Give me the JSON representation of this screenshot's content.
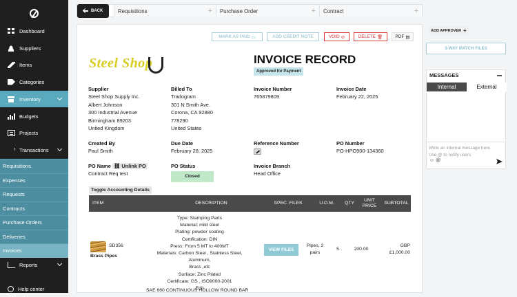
{
  "sidebar": {
    "items": [
      {
        "label": "Dashboard",
        "icon": "dashboard-icon"
      },
      {
        "label": "Suppliers",
        "icon": "users-icon"
      },
      {
        "label": "Items",
        "icon": "rocket-icon"
      },
      {
        "label": "Categories",
        "icon": "tag-icon"
      },
      {
        "label": "Inventory",
        "icon": "box-icon"
      },
      {
        "label": "Budgets",
        "icon": "bar-chart-icon"
      },
      {
        "label": "Projects",
        "icon": "sheet-icon"
      },
      {
        "label": "Transactions",
        "icon": "cart-icon"
      }
    ],
    "sub_items": [
      "Requisitions",
      "Expenses",
      "Requests",
      "Contracts",
      "Purchase Orders",
      "Deliveries",
      "Invoices"
    ],
    "reports": "Reports",
    "help": "Help center"
  },
  "topbar": {
    "back": "BACK",
    "tabs": [
      "Requisitions",
      "Purchase Order",
      "Contract"
    ]
  },
  "actions": {
    "mark_as_paid": "MARK AS PAID",
    "add_credit_note": "ADD CREDIT NOTE",
    "void": "VOID",
    "delete": "DELETE",
    "pdf": "PDF"
  },
  "invoice": {
    "brand": "Steel Shop",
    "title": "INVOICE RECORD",
    "status_badge": "Approved for Payment",
    "supplier": {
      "label": "Supplier",
      "lines": [
        "Steel Shop Supply Inc.",
        "Albert Johnson",
        "300 Industrial Avenue",
        "Birmingham 89203",
        "United Kingdom"
      ]
    },
    "billed_to": {
      "label": "Billed To",
      "lines": [
        "Tradogram",
        "301 N Smith Ave.",
        "Corona, CA 92880",
        "778290",
        "United States"
      ]
    },
    "invoice_number": {
      "label": "Invoice Number",
      "value": "765879809"
    },
    "invoice_date": {
      "label": "Invoice Date",
      "value": "February 22, 2025"
    },
    "created_by": {
      "label": "Created By",
      "value": "Paul Smith"
    },
    "due_date": {
      "label": "Due Date",
      "value": "February 28, 2025"
    },
    "reference_number": {
      "label": "Reference Number"
    },
    "po_number": {
      "label": "PO Number",
      "value": "PO-HPO900-134360"
    },
    "po_name": {
      "label": "PO Name",
      "unlink": "Unlink PO",
      "value": "Contract Req test"
    },
    "po_status": {
      "label": "PO Status",
      "value": "Closed"
    },
    "invoice_branch": {
      "label": "Invoice Branch",
      "value": "Head Office"
    },
    "toggle_accounting": "Toggle Accounting Details"
  },
  "table": {
    "headers": [
      "ITEM",
      "DESCRIPTION",
      "SPEC. FILES",
      "U.O.M.",
      "QTY",
      "UNIT PRICE",
      "SUBTOTAL"
    ],
    "row": {
      "sku": "SD356",
      "name": "Brass Pipes",
      "description": [
        "Type: Stamping Parts",
        "Material: mild steel",
        "Plating: powder coating",
        "Certification: DIN",
        "Press: From 5 MT to 400MT",
        "Materials: Carbon Steel , Stainless Steel, Aluminum,",
        "Brass ,etc",
        "Surface: Zinc Plated",
        "Certificate: GS , ISO9000-2001",
        "Edit"
      ],
      "view_files": "VIEW FILES",
      "uom": [
        "Pipes, 2",
        "pairs"
      ],
      "qty": "5",
      "unit_price": "200.00",
      "subtotal": [
        "GBP",
        "£1,000.00"
      ]
    },
    "next_row_partial": "SAE 660 CONTINUOUS HOLLOW ROUND BAR"
  },
  "right_panel": {
    "add_approver": "ADD APPROVER",
    "three_way_match": "3-WAY MATCH FILES",
    "messages": {
      "title": "MESSAGES",
      "tab_internal": "Internal",
      "tab_external": "External",
      "placeholder_line1": "Write an internal message here.",
      "placeholder_line2": "Use @ to notify users",
      "at": "@"
    }
  }
}
